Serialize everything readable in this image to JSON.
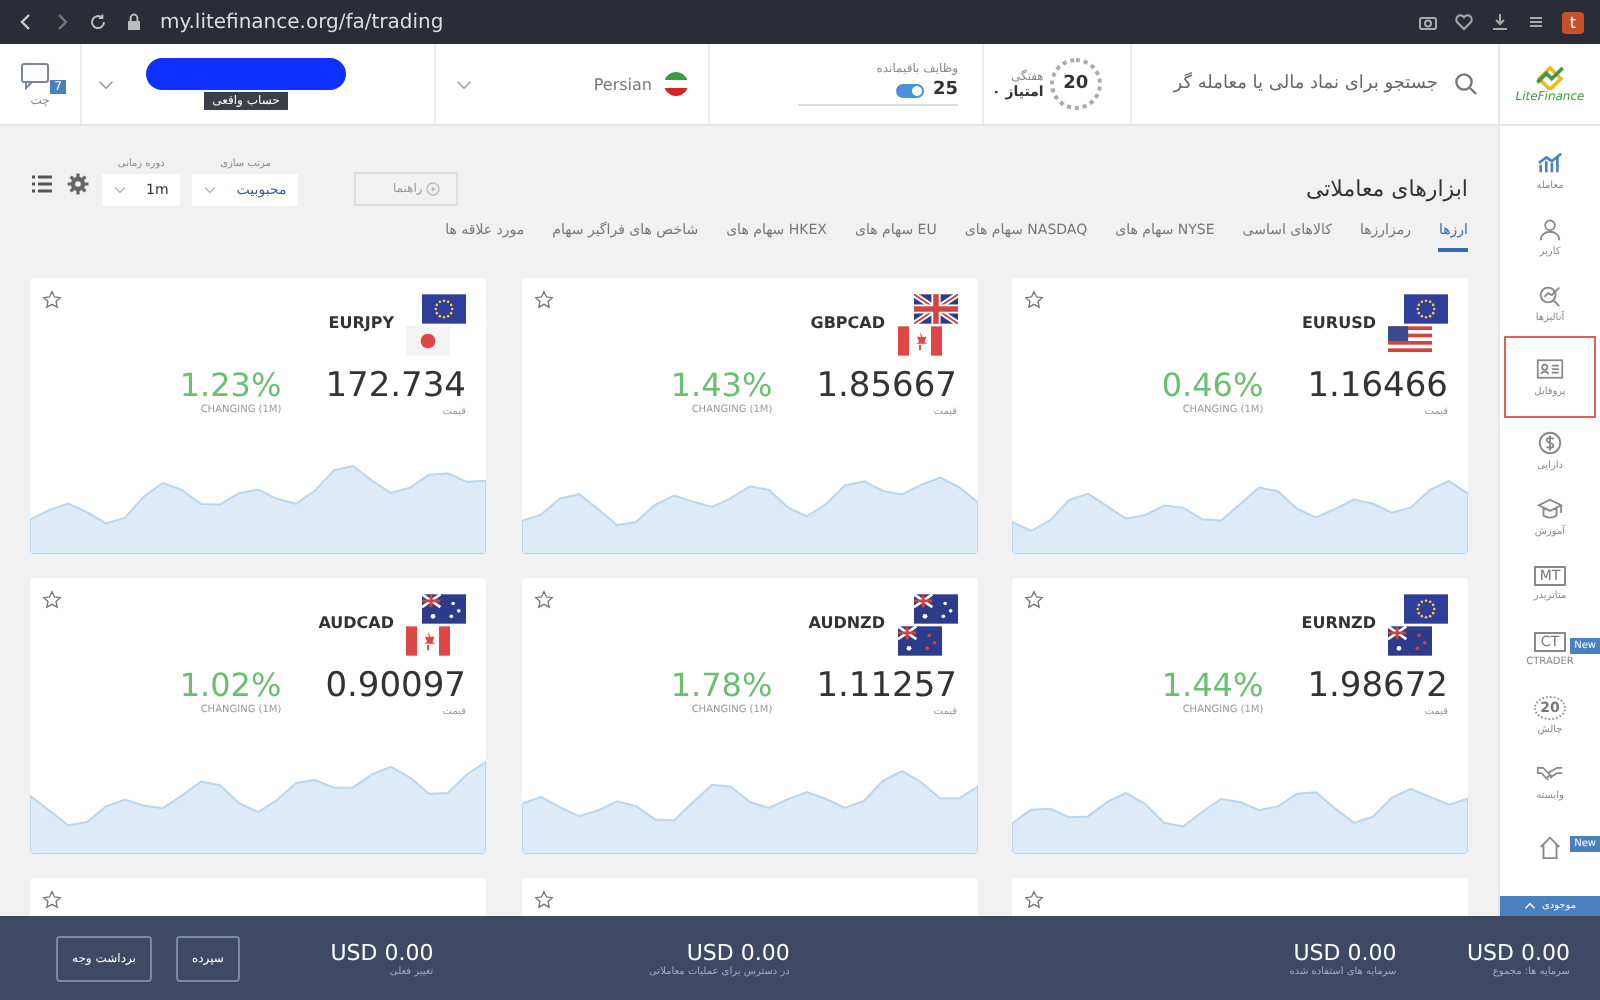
{
  "browser": {
    "url": "my.litefinance.org/fa/trading",
    "profile_badge": "t"
  },
  "header": {
    "logo": "LiteFinance",
    "search": {
      "placeholder": "جستجو برای نماد مالی یا معامله گر"
    },
    "weekly": {
      "badge": "20",
      "label": "هفتگی",
      "points": "۰ امتیاز"
    },
    "tasks": {
      "label": "وظایف باقیمانده",
      "count": "25",
      "on": true
    },
    "language": {
      "name": "Persian"
    },
    "account": {
      "type": "حساب واقعی"
    },
    "chat": {
      "label": "چت",
      "count": "7"
    }
  },
  "toolbar": {
    "title": "ابزارهای معاملاتی",
    "guide": "راهنما",
    "sort": {
      "label": "مرتب سازی",
      "value": "محبوبیت"
    },
    "period": {
      "label": "دوره زمانی",
      "value": "1m"
    }
  },
  "tabs": [
    {
      "label": "ارزها",
      "selected": true
    },
    {
      "label": "رمزارزها",
      "selected": false
    },
    {
      "label": "کالاهای اساسی",
      "selected": false
    },
    {
      "label": "سهام های NYSE",
      "selected": false
    },
    {
      "label": "سهام های NASDAQ",
      "selected": false
    },
    {
      "label": "سهام های EU",
      "selected": false
    },
    {
      "label": "سهام های HKEX",
      "selected": false
    },
    {
      "label": "شاخص های فراگیر سهام",
      "selected": false
    },
    {
      "label": "مورد علاقه ها",
      "selected": false
    }
  ],
  "instruments": [
    {
      "kind": "full",
      "symbol": "EURUSD",
      "flags": [
        {
          "kind": "eu"
        },
        {
          "kind": "us"
        }
      ],
      "price": "1.16466",
      "price_label": "قیمت",
      "change": "0.46%",
      "change_label": "CHANGING (1M)",
      "favorite": false
    },
    {
      "kind": "full",
      "symbol": "GBPCAD",
      "flags": [
        {
          "kind": "gb"
        },
        {
          "kind": "ca"
        }
      ],
      "price": "1.85667",
      "price_label": "قیمت",
      "change": "1.43%",
      "change_label": "CHANGING (1M)",
      "favorite": false
    },
    {
      "kind": "full",
      "symbol": "EURJPY",
      "flags": [
        {
          "kind": "eu"
        },
        {
          "kind": "jp"
        }
      ],
      "price": "172.734",
      "price_label": "قیمت",
      "change": "1.23%",
      "change_label": "CHANGING (1M)",
      "favorite": false
    },
    {
      "kind": "full",
      "symbol": "EURNZD",
      "flags": [
        {
          "kind": "eu"
        },
        {
          "kind": "nz"
        }
      ],
      "price": "1.98672",
      "price_label": "قیمت",
      "change": "1.44%",
      "change_label": "CHANGING (1M)",
      "favorite": false
    },
    {
      "kind": "full",
      "symbol": "AUDNZD",
      "flags": [
        {
          "kind": "au"
        },
        {
          "kind": "nz"
        }
      ],
      "price": "1.11257",
      "price_label": "قیمت",
      "change": "1.78%",
      "change_label": "CHANGING (1M)",
      "favorite": false
    },
    {
      "kind": "full",
      "symbol": "AUDCAD",
      "flags": [
        {
          "kind": "au"
        },
        {
          "kind": "ca"
        }
      ],
      "price": "0.90097",
      "price_label": "قیمت",
      "change": "1.02%",
      "change_label": "CHANGING (1M)",
      "favorite": false
    },
    {
      "kind": "partial"
    },
    {
      "kind": "partial"
    },
    {
      "kind": "partial"
    }
  ],
  "sidebar": [
    {
      "kind": "chart",
      "label": "معامله",
      "selected": false
    },
    {
      "kind": "user",
      "label": "کاربر",
      "selected": false
    },
    {
      "kind": "analysis",
      "label": "آنالیزها",
      "selected": false
    },
    {
      "kind": "profile",
      "label": "پروفایل",
      "selected": true
    },
    {
      "kind": "dollar",
      "label": "دارایی",
      "selected": false
    },
    {
      "kind": "cap",
      "label": "آموزش",
      "selected": false
    },
    {
      "kind": "mt",
      "label": "متاتریدر",
      "icon_text": "MT",
      "selected": false
    },
    {
      "kind": "ct",
      "label": "CTRADER",
      "icon_text": "CT",
      "badge": "New",
      "selected": false
    },
    {
      "kind": "laurel",
      "label": "چالش",
      "icon_text": "20",
      "selected": false
    },
    {
      "kind": "hands",
      "label": "وابسته",
      "selected": false
    },
    {
      "kind": "house",
      "badge": "New",
      "selected": false
    }
  ],
  "footer": {
    "tab": "موجودی",
    "balances": [
      {
        "label": "سرمایه ها: مجموع",
        "value": "USD 0.00"
      },
      {
        "label": "سرمایه های استفاده شده",
        "value": "USD 0.00"
      },
      {
        "label": "در دسترس برای عملیات معاملاتی",
        "value": "USD 0.00"
      },
      {
        "label": "تغییر فعلی",
        "value": "USD 0.00"
      }
    ],
    "buttons": [
      "سپرده",
      "برداشت وجه"
    ]
  }
}
